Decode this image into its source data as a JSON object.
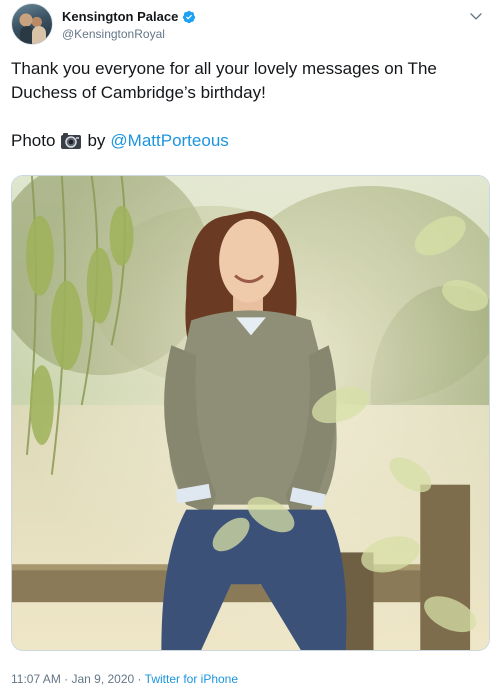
{
  "account": {
    "display_name": "Kensington Palace",
    "handle": "@KensingtonRoyal",
    "verified": true,
    "avatar_icon": "profile-avatar"
  },
  "tweet": {
    "text_line1": "Thank you everyone for all your lovely messages on The Duchess of Cambridge’s birthday!",
    "photo_label": "Photo",
    "photo_by": "by",
    "mention": "@MattPorteous"
  },
  "meta": {
    "time": "11:07 AM",
    "sep1": " · ",
    "date": "Jan 9, 2020",
    "sep2": " · ",
    "source": "Twitter for iPhone"
  },
  "colors": {
    "accent": "#1b95e0",
    "muted": "#657786",
    "verified": "#1da1f2"
  },
  "icons": {
    "verified": "verified-badge-icon",
    "more": "chevron-down-icon",
    "camera": "camera-emoji-icon"
  }
}
